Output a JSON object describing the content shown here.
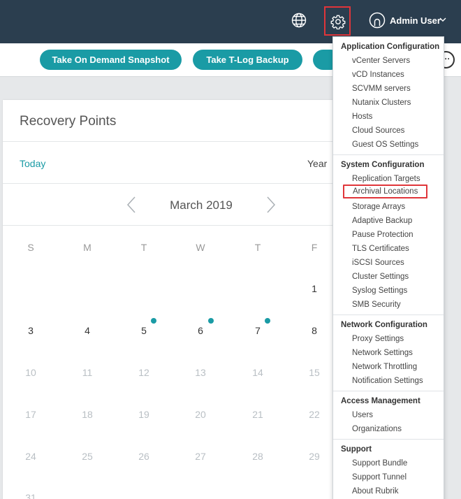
{
  "header": {
    "user_name": "Admin User",
    "icons": [
      "globe-icon",
      "gear-icon",
      "user-icon",
      "chevron-down-icon"
    ],
    "highlight_color": "#e0353a",
    "background": "#2b3e4f"
  },
  "actions": {
    "on_demand": "Take On Demand Snapshot",
    "tlog": "Take T-Log Backup",
    "accent": "#1a9ba5"
  },
  "recovery": {
    "title": "Recovery Points",
    "today": "Today",
    "year": "Year",
    "month": "March 2019",
    "weekdays": [
      "S",
      "M",
      "T",
      "W",
      "T",
      "F"
    ],
    "week1": [
      "1"
    ],
    "week2": [
      "3",
      "4",
      "5",
      "6",
      "7",
      "8"
    ],
    "week3": [
      "10",
      "11",
      "12",
      "13",
      "14",
      "15"
    ],
    "week4": [
      "17",
      "18",
      "19",
      "20",
      "21",
      "22"
    ],
    "week5": [
      "24",
      "25",
      "26",
      "27",
      "28",
      "29"
    ],
    "week6": [
      "31"
    ],
    "days_with_snapshots": [
      "5",
      "6",
      "7"
    ]
  },
  "menu": {
    "app_config": {
      "header": "Application Configuration",
      "items": [
        "vCenter Servers",
        "vCD Instances",
        "SCVMM servers",
        "Nutanix Clusters",
        "Hosts",
        "Cloud Sources",
        "Guest OS Settings"
      ]
    },
    "system_config": {
      "header": "System Configuration",
      "items": [
        "Replication Targets",
        "Archival Locations",
        "Storage Arrays",
        "Adaptive Backup",
        "Pause Protection",
        "TLS Certificates",
        "iSCSI Sources",
        "Cluster Settings",
        "Syslog Settings",
        "SMB Security"
      ],
      "highlighted": "Archival Locations"
    },
    "network_config": {
      "header": "Network Configuration",
      "items": [
        "Proxy Settings",
        "Network Settings",
        "Network Throttling",
        "Notification Settings"
      ]
    },
    "access": {
      "header": "Access Management",
      "items": [
        "Users",
        "Organizations"
      ]
    },
    "support": {
      "header": "Support",
      "items": [
        "Support Bundle",
        "Support Tunnel",
        "About Rubrik"
      ]
    }
  }
}
